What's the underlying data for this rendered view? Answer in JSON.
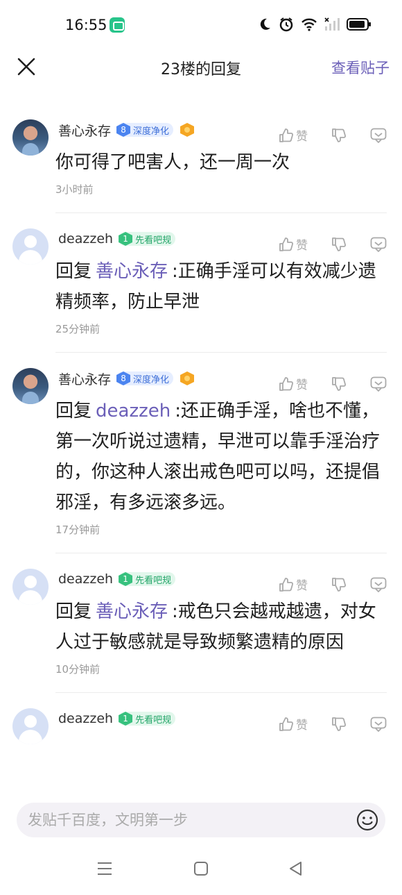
{
  "status": {
    "time": "16:55"
  },
  "header": {
    "title": "23楼的回复",
    "view_post": "查看贴子"
  },
  "comments": [
    {
      "username": "善心永存",
      "badge": {
        "level": "8",
        "text": "深度净化",
        "color": "#4b84f0"
      },
      "has_medal": true,
      "like_label": "赞",
      "reply_prefix": "",
      "mention": "",
      "text": "你可得了吧害人，还一周一次",
      "time": "3小时前"
    },
    {
      "username": "deazzeh",
      "badge": {
        "level": "1",
        "text": "先看吧规",
        "color": "#37c17e"
      },
      "has_medal": false,
      "like_label": "赞",
      "reply_prefix": "回复",
      "mention": "善心永存",
      "text": ":正确手淫可以有效减少遗精频率，防止早泄",
      "time": "25分钟前"
    },
    {
      "username": "善心永存",
      "badge": {
        "level": "8",
        "text": "深度净化",
        "color": "#4b84f0"
      },
      "has_medal": true,
      "like_label": "赞",
      "reply_prefix": "回复",
      "mention": "deazzeh",
      "text": ":还正确手淫，啥也不懂，第一次听说过遗精，早泄可以靠手淫治疗的，你这种人滚出戒色吧可以吗，还提倡邪淫，有多远滚多远。",
      "time": "17分钟前"
    },
    {
      "username": "deazzeh",
      "badge": {
        "level": "1",
        "text": "先看吧规",
        "color": "#37c17e"
      },
      "has_medal": false,
      "like_label": "赞",
      "reply_prefix": "回复",
      "mention": "善心永存",
      "text": ":戒色只会越戒越遗，对女人过于敏感就是导致频繁遗精的原因",
      "time": "10分钟前"
    },
    {
      "username": "deazzeh",
      "badge": {
        "level": "1",
        "text": "先看吧规",
        "color": "#37c17e"
      },
      "has_medal": false,
      "like_label": "赞",
      "reply_prefix": "",
      "mention": "",
      "text": "",
      "time": ""
    }
  ],
  "input": {
    "placeholder": "发贴千百度，文明第一步"
  }
}
